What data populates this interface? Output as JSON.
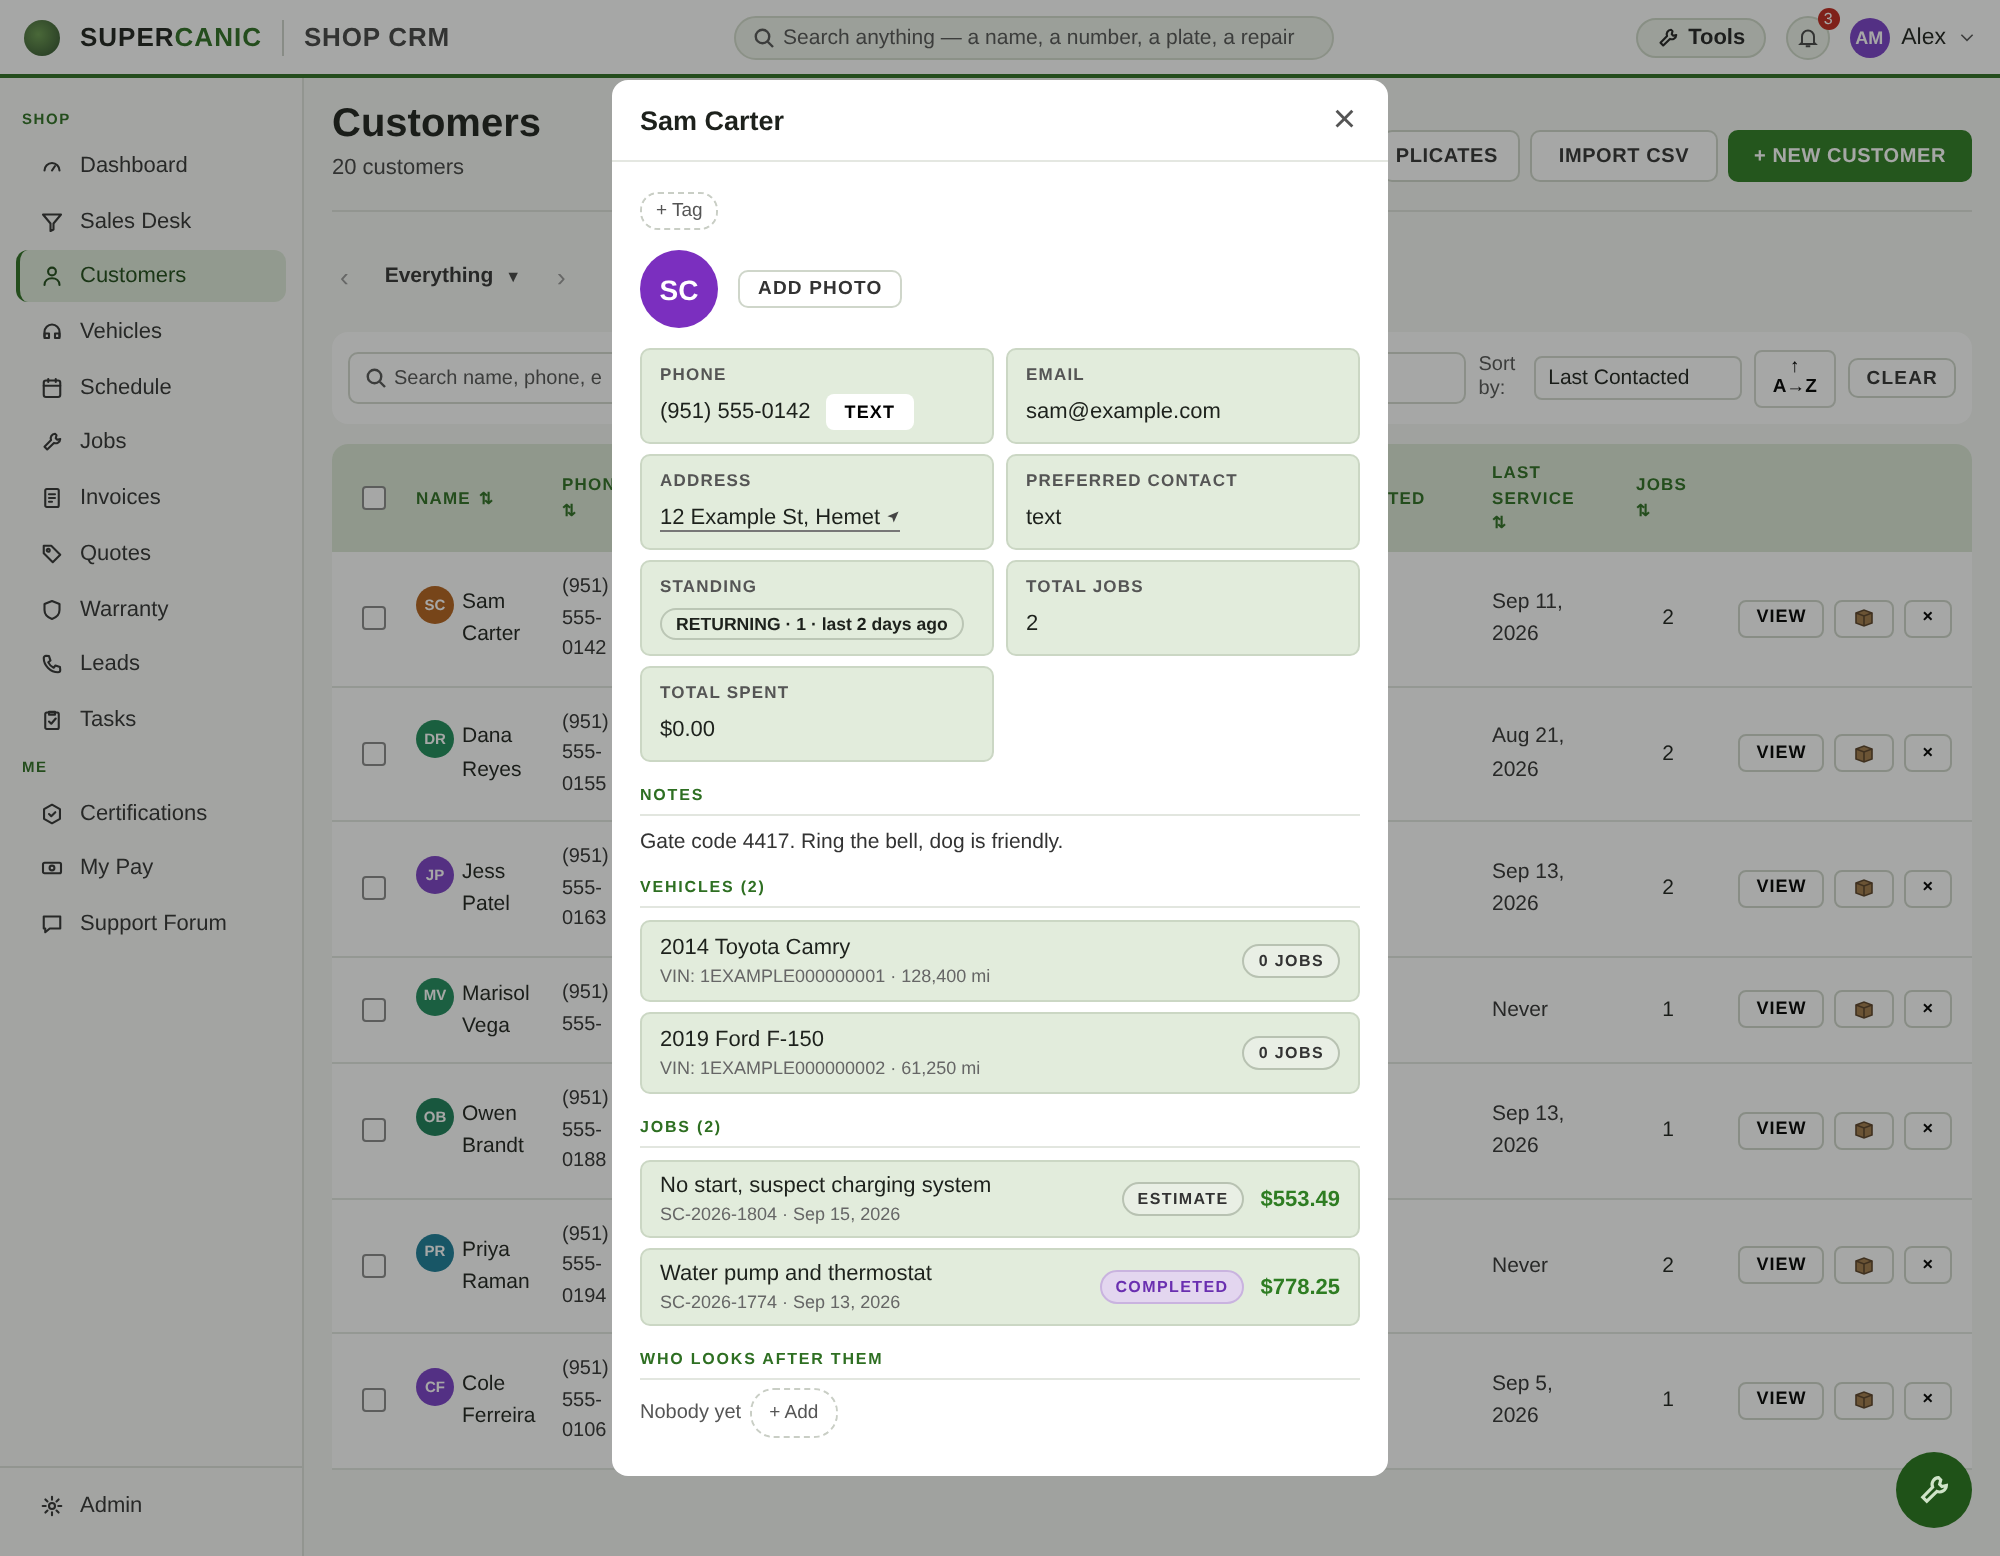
{
  "topbar": {
    "brand": {
      "text": "SUPER",
      "accent": "CANIC"
    },
    "product": "SHOP CRM",
    "search": {
      "placeholder": "Search anything — a name, a number, a plate, a repair"
    },
    "tools": "Tools",
    "notifications": "3",
    "user": {
      "initials": "AM",
      "name": "Alex"
    }
  },
  "sidebar": {
    "sections": [
      {
        "label": "SHOP",
        "items": [
          {
            "label": "Dashboard",
            "selected": false
          },
          {
            "label": "Sales Desk",
            "selected": false
          },
          {
            "label": "Customers",
            "selected": true
          },
          {
            "label": "Vehicles",
            "selected": false
          },
          {
            "label": "Schedule",
            "selected": false
          },
          {
            "label": "Jobs",
            "selected": false
          },
          {
            "label": "Invoices",
            "selected": false
          },
          {
            "label": "Quotes",
            "selected": false
          },
          {
            "label": "Warranty",
            "selected": false
          },
          {
            "label": "Leads",
            "selected": false
          },
          {
            "label": "Tasks",
            "selected": false
          }
        ]
      },
      {
        "label": "ME",
        "items": [
          {
            "label": "Certifications",
            "selected": false
          },
          {
            "label": "My Pay",
            "selected": false
          },
          {
            "label": "Support Forum",
            "selected": false
          }
        ]
      }
    ],
    "footer": {
      "label": "Admin"
    }
  },
  "page": {
    "title": "Customers",
    "subtitle": "20 customers",
    "actions": [
      {
        "label": "PLICATES",
        "kind": "outline"
      },
      {
        "label": "IMPORT CSV",
        "kind": "outline"
      },
      {
        "label": "+ NEW CUSTOMER",
        "kind": "primary"
      }
    ]
  },
  "filter": {
    "prev": "‹",
    "label": "Everything",
    "caret": "▼",
    "next": "›"
  },
  "toolbar": {
    "search": {
      "placeholder": "Search name, phone, e"
    },
    "sort_label": "Sort by:",
    "sort_value": "Last Contacted",
    "direction": {
      "arrow": "↑",
      "label": "A→Z"
    },
    "clear": "CLEAR"
  },
  "table": {
    "header_checked": false,
    "columns": [
      {
        "label": "NAME",
        "sort": "⇅"
      },
      {
        "label": "PHON",
        "sort": "⇅"
      },
      {
        "label": "TED"
      },
      {
        "label": "LAST SERVICE",
        "sort": "⇅"
      },
      {
        "label": "JOBS",
        "sort": "⇅"
      }
    ],
    "rows": [
      {
        "checked": false,
        "initials": "SC",
        "color": "#774519",
        "name": "Sam Carter",
        "phone": "(951) 555-0142",
        "last_service": "Sep 11, 2026",
        "jobs": "2",
        "view": "VIEW",
        "delete": "×"
      },
      {
        "checked": false,
        "initials": "DR",
        "color": "#1a5f3f",
        "name": "Dana Reyes",
        "phone": "(951) 555-0155",
        "last_service": "Aug 21, 2026",
        "jobs": "2",
        "view": "VIEW",
        "delete": "×"
      },
      {
        "checked": false,
        "initials": "JP",
        "color": "#543082",
        "name": "Jess Patel",
        "phone": "(951) 555-0163",
        "last_service": "Sep 13, 2026",
        "jobs": "2",
        "view": "VIEW",
        "delete": "×"
      },
      {
        "checked": false,
        "initials": "MV",
        "color": "#1b5f41",
        "name": "Marisol Vega",
        "phone": "(951) 555-",
        "last_service": "Never",
        "jobs": "1",
        "view": "VIEW",
        "delete": "×"
      },
      {
        "checked": false,
        "initials": "OB",
        "color": "#18583e",
        "name": "Owen Brandt",
        "phone": "(951) 555-0188",
        "last_service": "Sep 13, 2026",
        "jobs": "1",
        "view": "VIEW",
        "delete": "×"
      },
      {
        "checked": false,
        "initials": "PR",
        "color": "#185666",
        "name": "Priya Raman",
        "phone": "(951) 555-0194",
        "last_service": "Never",
        "jobs": "2",
        "view": "VIEW",
        "delete": "×"
      },
      {
        "checked": false,
        "initials": "CF",
        "color": "#533084",
        "name": "Cole Ferreira",
        "phone": "(951) 555-0106",
        "last_service": "Sep 5, 2026",
        "jobs": "1",
        "view": "VIEW",
        "delete": "×"
      }
    ]
  },
  "modal": {
    "title": "Sam Carter",
    "close": "×",
    "tag": "+ Tag",
    "avatar": "SC",
    "add_photo": "ADD PHOTO",
    "fields": [
      {
        "label": "PHONE",
        "value": "(951) 555-0142",
        "kind": "phone",
        "action": "TEXT"
      },
      {
        "label": "EMAIL",
        "value": "sam@example.com",
        "kind": "plain"
      },
      {
        "label": "ADDRESS",
        "value": "12 Example St, Hemet",
        "kind": "address"
      },
      {
        "label": "PREFERRED CONTACT",
        "value": "text",
        "kind": "plain"
      },
      {
        "label": "STANDING",
        "value": "RETURNING · 1 · last 2 days ago",
        "kind": "pill"
      },
      {
        "label": "TOTAL JOBS",
        "value": "2",
        "kind": "plain"
      },
      {
        "label": "TOTAL SPENT",
        "value": "$0.00",
        "kind": "plain"
      }
    ],
    "notes": {
      "heading": "NOTES",
      "text": "Gate code 4417. Ring the bell, dog is friendly."
    },
    "vehicles": {
      "heading": "VEHICLES (2)",
      "items": [
        {
          "title": "2014 Toyota Camry",
          "detail": "VIN: 1EXAMPLE000000001 · 128,400 mi",
          "badge": "0 JOBS"
        },
        {
          "title": "2019 Ford F-150",
          "detail": "VIN: 1EXAMPLE000000002 · 61,250 mi",
          "badge": "0 JOBS"
        }
      ]
    },
    "jobs": {
      "heading": "JOBS (2)",
      "items": [
        {
          "title": "No start, suspect charging system",
          "detail": "SC-2026-1804 · Sep 15, 2026",
          "status": "ESTIMATE",
          "kind": "estimate",
          "amount": "$553.49"
        },
        {
          "title": "Water pump and thermostat",
          "detail": "SC-2026-1774 · Sep 13, 2026",
          "status": "COMPLETED",
          "kind": "completed",
          "amount": "$778.25"
        }
      ]
    },
    "care": {
      "heading": "WHO LOOKS AFTER THEM",
      "empty": "Nobody yet",
      "add": "+ Add"
    }
  }
}
